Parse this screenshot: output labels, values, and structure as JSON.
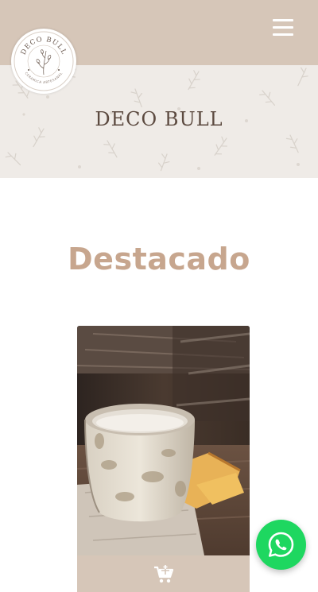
{
  "header": {
    "logo_top_text": "DECO BULL",
    "logo_bottom_text": "CERAMICA ARTESANAL",
    "menu_icon": "hamburger-menu-icon"
  },
  "hero": {
    "title": "DECO BULL"
  },
  "main": {
    "section_title": "Destacado"
  },
  "product": {
    "cart_icon": "add-to-cart-icon"
  },
  "floating": {
    "whatsapp_icon": "whatsapp-icon"
  },
  "colors": {
    "header_bg": "#d6c6b8",
    "hero_bg": "#efebe7",
    "accent": "#c7a68e",
    "whatsapp": "#1ed760"
  }
}
